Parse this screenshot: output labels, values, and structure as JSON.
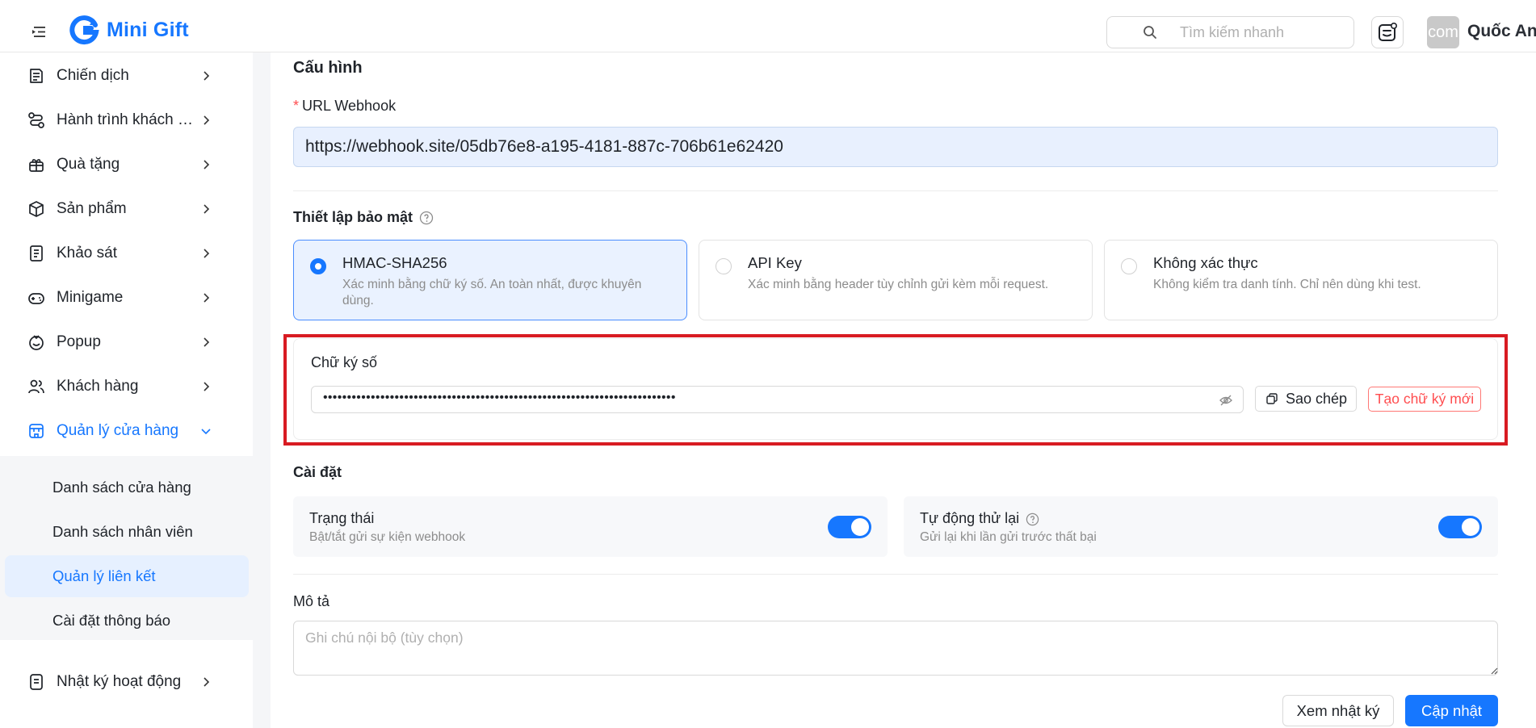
{
  "app": {
    "name": "Mini Gift"
  },
  "header": {
    "search_placeholder": "Tìm kiếm nhanh",
    "avatar_text": "com",
    "user_name": "Quốc An"
  },
  "sidebar": {
    "items": [
      {
        "label": "Chiến dịch",
        "icon": "campaign-icon"
      },
      {
        "label": "Hành trình khách hàng",
        "icon": "journey-icon"
      },
      {
        "label": "Quà tặng",
        "icon": "gift-icon"
      },
      {
        "label": "Sản phẩm",
        "icon": "box-icon"
      },
      {
        "label": "Khảo sát",
        "icon": "survey-icon"
      },
      {
        "label": "Minigame",
        "icon": "gamepad-icon"
      },
      {
        "label": "Popup",
        "icon": "popup-icon"
      },
      {
        "label": "Khách hàng",
        "icon": "users-icon"
      },
      {
        "label": "Quản lý cửa hàng",
        "icon": "store-icon",
        "expanded": true
      },
      {
        "label": "Nhật ký hoạt động",
        "icon": "log-icon"
      }
    ],
    "sub_items": [
      {
        "label": "Danh sách cửa hàng"
      },
      {
        "label": "Danh sách nhân viên"
      },
      {
        "label": "Quản lý liên kết",
        "active": true
      },
      {
        "label": "Cài đặt thông báo"
      }
    ]
  },
  "config": {
    "title": "Cấu hình",
    "url_label": "URL Webhook",
    "url_value": "https://webhook.site/05db76e8-a195-4181-887c-706b61e62420",
    "security_title": "Thiết lập bảo mật",
    "options": [
      {
        "title": "HMAC-SHA256",
        "desc": "Xác minh bằng chữ ký số. An toàn nhất, được khuyên dùng.",
        "selected": true
      },
      {
        "title": "API Key",
        "desc": "Xác minh bằng header tùy chỉnh gửi kèm mỗi request.",
        "selected": false
      },
      {
        "title": "Không xác thực",
        "desc": "Không kiểm tra danh tính. Chỉ nên dùng khi test.",
        "selected": false
      }
    ],
    "signature_label": "Chữ ký số",
    "signature_value": "••••••••••••••••••••••••••••••••••••••••••••••••••••••••••••••••••••••••••",
    "copy_label": "Sao chép",
    "new_signature_label": "Tạo chữ ký mới"
  },
  "settings": {
    "title": "Cài đặt",
    "status": {
      "title": "Trạng thái",
      "desc": "Bật/tắt gửi sự kiện webhook",
      "on": true
    },
    "retry": {
      "title": "Tự động thử lại",
      "desc": "Gửi lại khi lần gửi trước thất bại",
      "on": true
    }
  },
  "description": {
    "label": "Mô tả",
    "placeholder": "Ghi chú nội bộ (tùy chọn)"
  },
  "actions": {
    "view_log": "Xem nhật ký",
    "update": "Cập nhật"
  },
  "colors": {
    "primary": "#1677ff",
    "danger": "#ff4d4f",
    "highlight_border": "#d81b22"
  }
}
